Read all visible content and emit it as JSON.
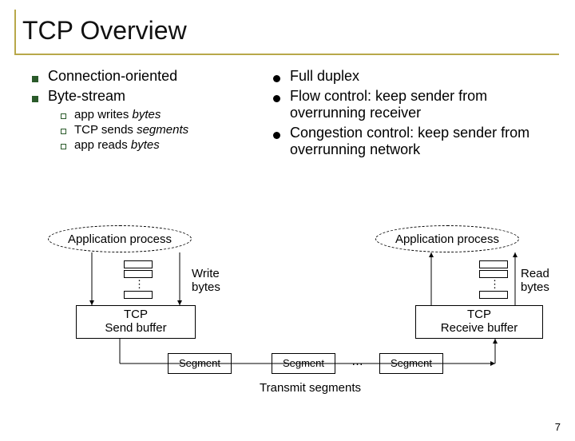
{
  "title": "TCP Overview",
  "left": {
    "items": [
      "Connection-oriented",
      "Byte-stream"
    ],
    "sub": [
      {
        "pre": "app writes ",
        "em": "bytes",
        "post": ""
      },
      {
        "pre": "TCP sends ",
        "em": "segments",
        "post": ""
      },
      {
        "pre": "app reads ",
        "em": "bytes",
        "post": ""
      }
    ]
  },
  "right": {
    "items": [
      "Full duplex",
      "Flow control: keep sender from overrunning receiver",
      "Congestion control: keep sender from overrunning network"
    ]
  },
  "diagram": {
    "app_left": "Application process",
    "app_right": "Application process",
    "write": "Write\nbytes",
    "read": "Read\nbytes",
    "sendbuf": "TCP\nSend buffer",
    "recvbuf": "TCP\nReceive buffer",
    "segment": "Segment",
    "ellipsis": "…",
    "transmit": "Transmit segments"
  },
  "pagenum": "7"
}
